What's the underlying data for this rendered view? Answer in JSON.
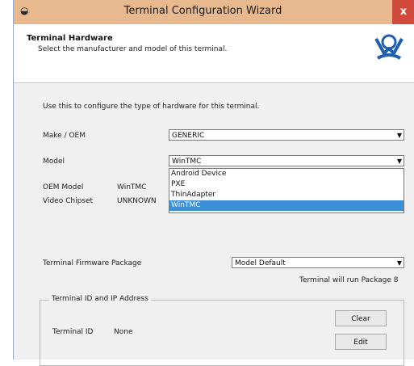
{
  "window": {
    "title": "Terminal Configuration Wizard",
    "close_glyph": "x"
  },
  "header": {
    "title": "Terminal Hardware",
    "subtitle": "Select the manufacturer and model of this terminal."
  },
  "intro": "Use this to configure the type of hardware for this terminal.",
  "make": {
    "label": "Make / OEM",
    "value": "GENERIC"
  },
  "model": {
    "label": "Model",
    "value": "WinTMC",
    "options": [
      "Android Device",
      "PXE",
      "ThinAdapter",
      "WinTMC"
    ],
    "selected": "WinTMC"
  },
  "oem_model": {
    "label": "OEM Model",
    "value": "WinTMC"
  },
  "video_chipset": {
    "label": "Video Chipset",
    "value": "UNKNOWN"
  },
  "firmware": {
    "label": "Terminal Firmware Package",
    "value": "Model Default",
    "note": "Terminal will run Package 8"
  },
  "terminal_id_group": {
    "legend": "Terminal ID and IP Address",
    "id_label": "Terminal ID",
    "id_value": "None",
    "clear_label": "Clear",
    "edit_label": "Edit"
  },
  "colors": {
    "titlebar": "#e8b98f",
    "close_button": "#cf4a3a",
    "selection": "#3d8fd6",
    "logo": "#1f5fb0"
  }
}
